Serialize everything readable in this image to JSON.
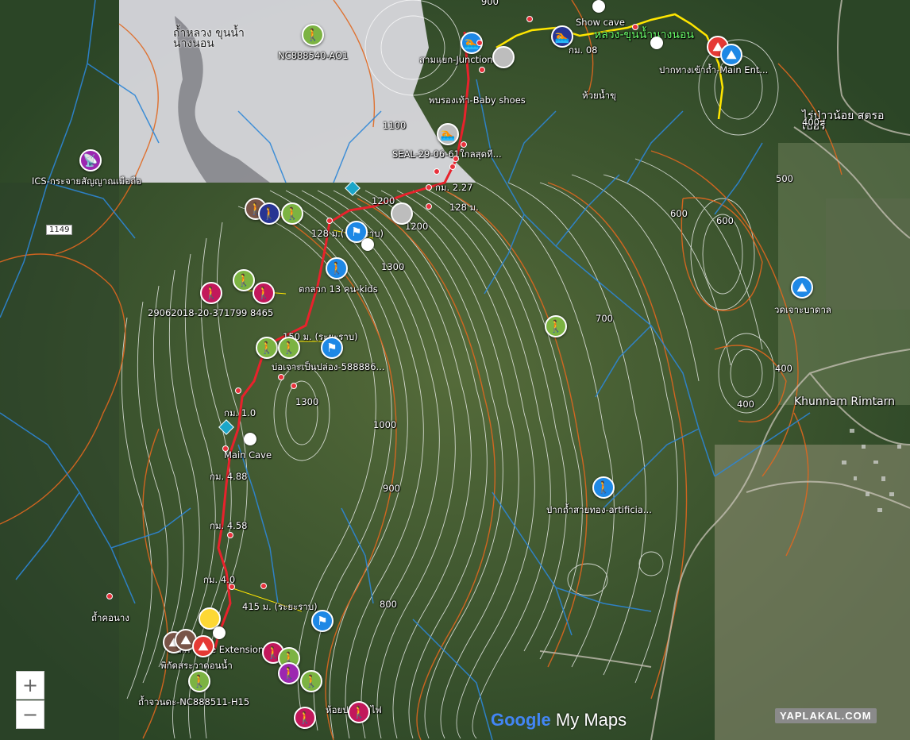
{
  "map": {
    "labels": [
      {
        "text": "NC888540-AO1"
      },
      {
        "text": "ICS-กระจายสัญญาณเมือถือ"
      },
      {
        "text": "สามแยก-Junction"
      },
      {
        "text": "พบรองเท้า-Baby shoes"
      },
      {
        "text": "SEAL-29-06-61ใกลสุดที..."
      },
      {
        "text": "Show cave"
      },
      {
        "text": "หลวง-ขุนน้ำนางนอน"
      },
      {
        "text": "ปากทางเข้าถ้ำ-Main Ent..."
      },
      {
        "text": "ห้วยน้ำขุ"
      },
      {
        "text": "ไร่ป่าวน้อย สตรอเบอรี่"
      },
      {
        "text": "กม. 2.27"
      },
      {
        "text": "128 ม."
      },
      {
        "text": "128 ม.(ระยะราบ)"
      },
      {
        "text": "ตกลวก 13 คน-kids"
      },
      {
        "text": "29062018-20-371799 8465"
      },
      {
        "text": "150 ม. (ระยะราบ)"
      },
      {
        "text": "บ่อเจาะเป็นปล่อง-588886..."
      },
      {
        "text": "กม. 1.0"
      },
      {
        "text": "Main Cave"
      },
      {
        "text": "กม. 4.88"
      },
      {
        "text": "กม. 4.58"
      },
      {
        "text": "กม. 4.0"
      },
      {
        "text": "415 ม. (ระยะราบ)"
      },
      {
        "text": "ถ้ำคอนาง"
      },
      {
        "text": "Main Cave Extensions"
      },
      {
        "text": "พิกัดสระวาดอนน้ำ"
      },
      {
        "text": "ถ้ำจวนดะ-NC888511-H15"
      },
      {
        "text": "ห้อยปากตับไฟ"
      },
      {
        "text": "ปากถ้ำสายทอง-artificia..."
      },
      {
        "text": "วดเจาะบาดาล"
      },
      {
        "text": "Khunnam Rimtarn"
      },
      {
        "text": "ถ้ำหลวง ขุนน้ำนางนอน"
      },
      {
        "text": "กม. 08"
      }
    ],
    "contour_labels": [
      "900",
      "1100",
      "1200",
      "1200",
      "1300",
      "1300",
      "1000",
      "900",
      "800",
      "700",
      "600",
      "600",
      "500",
      "400",
      "400",
      "400",
      "1300"
    ],
    "road_shield": "1149",
    "colors": {
      "route_red": "#e8222c",
      "route_yellow": "#ffe600",
      "contour_white": "#ffffff",
      "contour_orange": "#e0671f",
      "stream_blue": "#2d86d6",
      "forest": "#2f4a2a"
    }
  },
  "controls": {
    "zoom_in": "+",
    "zoom_out": "−"
  },
  "branding": {
    "logo_google": "Google",
    "logo_mymaps": " My Maps",
    "watermark": "YAPLAKAL.COM"
  }
}
